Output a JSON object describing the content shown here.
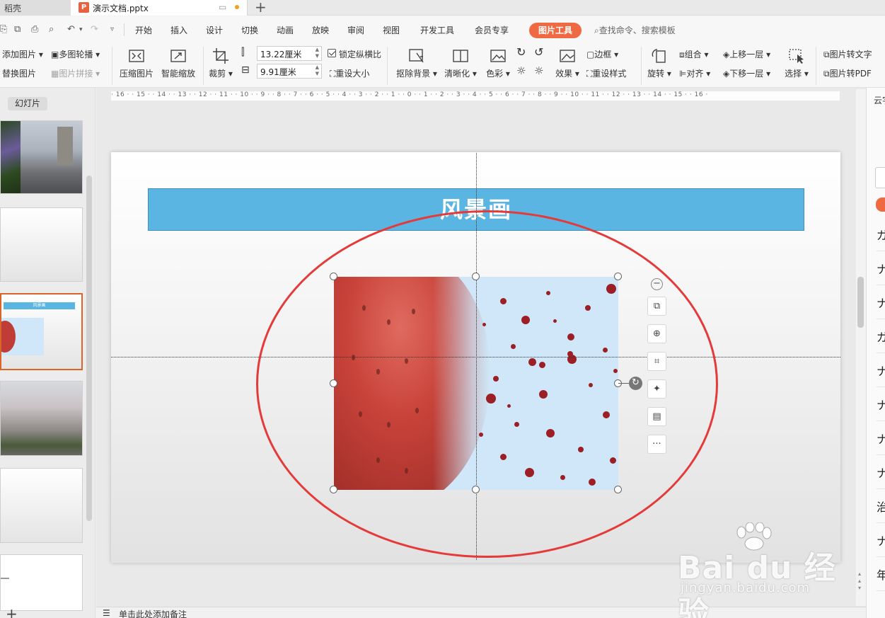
{
  "tabs": {
    "app": "稻壳",
    "document": "演示文档.pptx",
    "new_tab": "+"
  },
  "menu": {
    "items": [
      "开始",
      "插入",
      "设计",
      "切换",
      "动画",
      "放映",
      "审阅",
      "视图",
      "开发工具",
      "会员专享"
    ],
    "active": "图片工具",
    "search": "查找命令、搜索模板"
  },
  "ribbon": {
    "add_picture": "添加图片",
    "replace_picture": "替换图片",
    "multi_carousel": "多图轮播",
    "picture_collage": "图片拼接",
    "compress": "压缩图片",
    "smart_scale": "智能缩放",
    "crop": "裁剪",
    "width": "13.22厘米",
    "height": "9.91厘米",
    "lock_ratio": "锁定纵横比",
    "reset_size": "重设大小",
    "remove_bg": "抠除背景",
    "sharpen": "清晰化",
    "color": "色彩",
    "effect": "效果",
    "border": "边框",
    "reset_style": "重设样式",
    "rotate": "旋转",
    "group": "组合",
    "align": "对齐",
    "bring_forward": "上移一层",
    "send_backward": "下移一层",
    "select": "选择",
    "to_text": "图片转文字",
    "to_pdf": "图片转PDF"
  },
  "left_panel": {
    "tab": "幻灯片",
    "add": "+"
  },
  "ruler": "· 16 · · 15 · · 14 · · 13 · · 12 · · 11 · · 10 · · 9 · · 8 · · 7 · · 6 · · 5 · · 4 · · 3 · · 2 · · 1 · · 0 · · 1 · · 2 · · 3 · · 4 · · 5 · · 6 · · 7 · · 8 · · 9 · · 10 · · 11 · · 12 · · 13 · · 14 · · 15 · · 16 ·",
  "slide": {
    "title": "风景画",
    "thumb_title": "风景画"
  },
  "notes": {
    "placeholder": "单击此处添加备注"
  },
  "right_panel": {
    "label": "云字",
    "items": [
      "ガ",
      "ナ",
      "ナ",
      "ガ",
      "ナ",
      "ナ",
      "ナ",
      "ナ",
      "治",
      "ナ",
      "年"
    ]
  },
  "float_toolbar": {
    "more": "···"
  },
  "watermark": {
    "brand": "Bai du 经验",
    "url": "jingyan.baidu.com"
  },
  "colors": {
    "accent": "#ef6a43",
    "title_fill": "#5ab5e2",
    "ellipse": "#e53a3a",
    "active_thumb": "#d8662a"
  }
}
